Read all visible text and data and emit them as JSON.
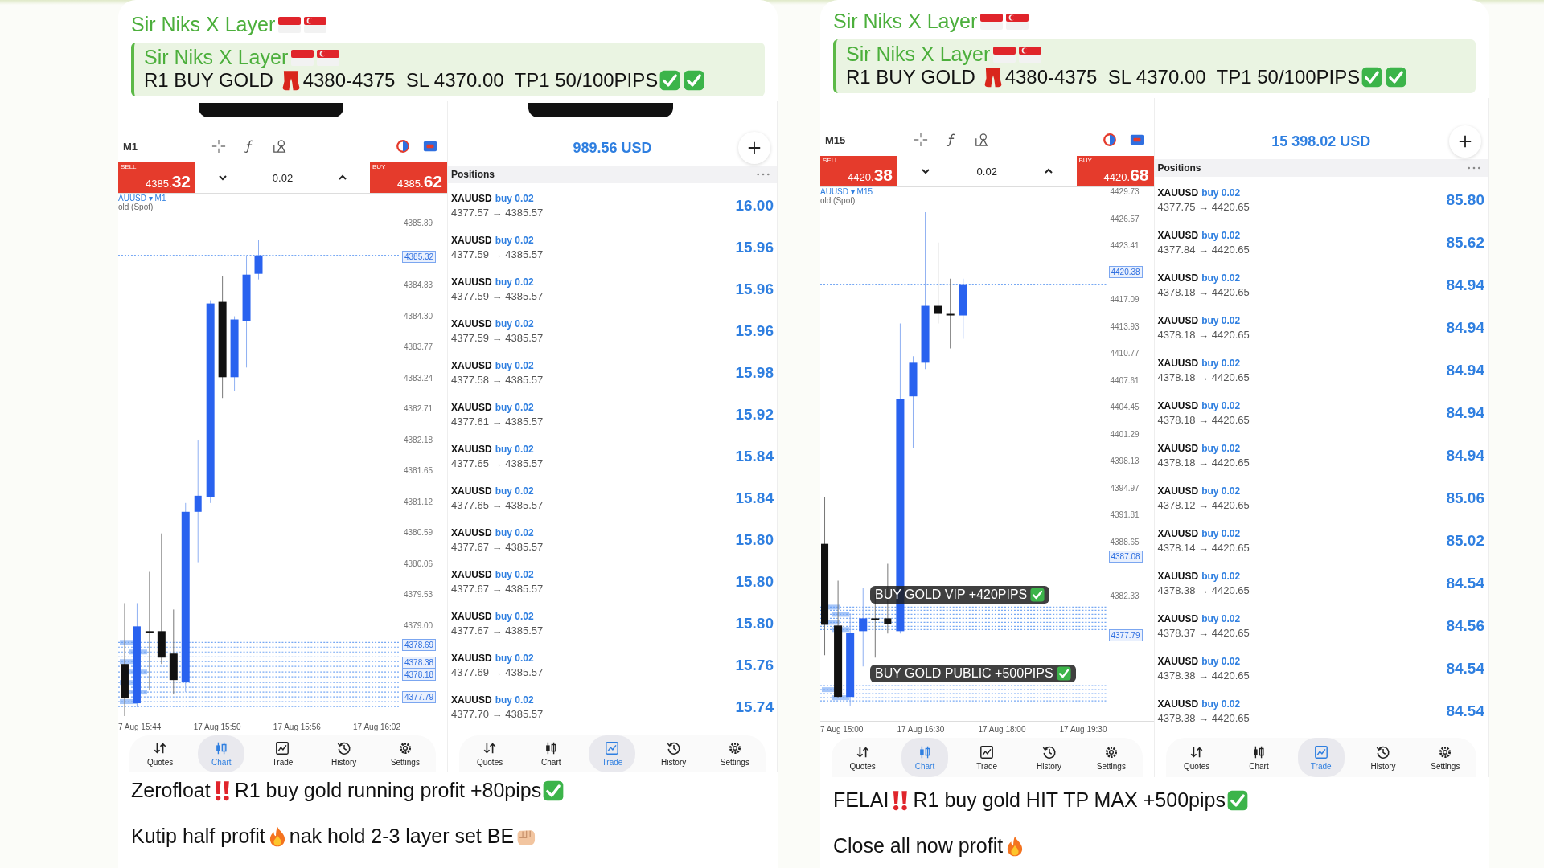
{
  "messages": [
    {
      "sender": "Sir Niks X Layer",
      "reply": {
        "sender": "Sir Niks X Layer",
        "segments": [
          {
            "kind": "text",
            "text": "R1 BUY GOLD "
          },
          {
            "kind": "boots"
          },
          {
            "kind": "text",
            "text": "4380-4375  SL 4370.00  TP1 50/100PIPS"
          },
          {
            "kind": "check"
          },
          {
            "kind": "check"
          }
        ]
      },
      "chart_screen": {
        "notch": true,
        "timeframe": "M1",
        "sell": {
          "label": "SELL",
          "price_main": "4385.",
          "price_big": "32"
        },
        "lot": "0.02",
        "buy": {
          "label": "BUY",
          "price_main": "4385.",
          "price_big": "62"
        },
        "symbol_line": "AUUSD ▾ M1",
        "description": "old (Spot)",
        "y_axis": [
          {
            "label": "4385.89",
            "kind": "tick"
          },
          {
            "label": "4385.32",
            "kind": "tag"
          },
          {
            "label": "4384.83",
            "kind": "tick"
          },
          {
            "label": "4384.30",
            "kind": "tick"
          },
          {
            "label": "4383.77",
            "kind": "tick"
          },
          {
            "label": "4383.24",
            "kind": "tick"
          },
          {
            "label": "4382.71",
            "kind": "tick"
          },
          {
            "label": "4382.18",
            "kind": "tick"
          },
          {
            "label": "4381.65",
            "kind": "tick"
          },
          {
            "label": "4381.12",
            "kind": "tick"
          },
          {
            "label": "4380.59",
            "kind": "tick"
          },
          {
            "label": "4380.06",
            "kind": "tick"
          },
          {
            "label": "4379.53",
            "kind": "tick"
          },
          {
            "label": "4379.00",
            "kind": "tick"
          },
          {
            "label": "4378.69",
            "kind": "tag"
          },
          {
            "label": "4378.38",
            "kind": "tag"
          },
          {
            "label": "4378.18",
            "kind": "tag"
          },
          {
            "label": "4377.79",
            "kind": "tag"
          }
        ],
        "x_axis": [
          "7 Aug 15:44",
          "17 Aug 15:50",
          "17 Aug 15:56",
          "17 Aug 16:02"
        ],
        "nav": [
          {
            "label": "Quotes",
            "selected": false
          },
          {
            "label": "Chart",
            "selected": true
          },
          {
            "label": "Trade",
            "selected": false
          },
          {
            "label": "History",
            "selected": false
          },
          {
            "label": "Settings",
            "selected": false
          }
        ]
      },
      "trade_screen": {
        "notch": true,
        "balance": "989.56 USD",
        "positions_title": "Positions",
        "positions": [
          {
            "symbol": "XAUUSD",
            "side": "buy 0.02",
            "prices": "4377.57 → 4385.57",
            "profit": "16.00"
          },
          {
            "symbol": "XAUUSD",
            "side": "buy 0.02",
            "prices": "4377.59 → 4385.57",
            "profit": "15.96"
          },
          {
            "symbol": "XAUUSD",
            "side": "buy 0.02",
            "prices": "4377.59 → 4385.57",
            "profit": "15.96"
          },
          {
            "symbol": "XAUUSD",
            "side": "buy 0.02",
            "prices": "4377.59 → 4385.57",
            "profit": "15.96"
          },
          {
            "symbol": "XAUUSD",
            "side": "buy 0.02",
            "prices": "4377.58 → 4385.57",
            "profit": "15.98"
          },
          {
            "symbol": "XAUUSD",
            "side": "buy 0.02",
            "prices": "4377.61 → 4385.57",
            "profit": "15.92"
          },
          {
            "symbol": "XAUUSD",
            "side": "buy 0.02",
            "prices": "4377.65 → 4385.57",
            "profit": "15.84"
          },
          {
            "symbol": "XAUUSD",
            "side": "buy 0.02",
            "prices": "4377.65 → 4385.57",
            "profit": "15.84"
          },
          {
            "symbol": "XAUUSD",
            "side": "buy 0.02",
            "prices": "4377.67 → 4385.57",
            "profit": "15.80"
          },
          {
            "symbol": "XAUUSD",
            "side": "buy 0.02",
            "prices": "4377.67 → 4385.57",
            "profit": "15.80"
          },
          {
            "symbol": "XAUUSD",
            "side": "buy 0.02",
            "prices": "4377.67 → 4385.57",
            "profit": "15.80"
          },
          {
            "symbol": "XAUUSD",
            "side": "buy 0.02",
            "prices": "4377.69 → 4385.57",
            "profit": "15.76"
          },
          {
            "symbol": "XAUUSD",
            "side": "buy 0.02",
            "prices": "4377.70 → 4385.57",
            "profit": "15.74"
          }
        ],
        "nav": [
          {
            "label": "Quotes",
            "selected": false
          },
          {
            "label": "Chart",
            "selected": false
          },
          {
            "label": "Trade",
            "selected": true
          },
          {
            "label": "History",
            "selected": false
          },
          {
            "label": "Settings",
            "selected": false
          }
        ]
      },
      "caption_lines": [
        [
          {
            "kind": "text",
            "text": "Zerofloat"
          },
          {
            "kind": "alert"
          },
          {
            "kind": "text",
            "text": "R1 buy gold running profit +80pips"
          },
          {
            "kind": "check"
          }
        ],
        [
          {
            "kind": "text",
            "text": "Kutip half profit"
          },
          {
            "kind": "fire"
          },
          {
            "kind": "text",
            "text": "nak hold 2-3 layer set BE"
          },
          {
            "kind": "fist"
          }
        ]
      ]
    },
    {
      "sender": "Sir Niks X Layer",
      "reply": {
        "sender": "Sir Niks X Layer",
        "segments": [
          {
            "kind": "text",
            "text": "R1 BUY GOLD "
          },
          {
            "kind": "boots"
          },
          {
            "kind": "text",
            "text": "4380-4375  SL 4370.00  TP1 50/100PIPS"
          },
          {
            "kind": "check"
          },
          {
            "kind": "check"
          }
        ]
      },
      "chart_screen": {
        "notch": false,
        "timeframe": "M15",
        "sell": {
          "label": "SELL",
          "price_main": "4420.",
          "price_big": "38"
        },
        "lot": "0.02",
        "buy": {
          "label": "BUY",
          "price_main": "4420.",
          "price_big": "68"
        },
        "symbol_line": "AUUSD ▾ M15",
        "description": "old (Spot)",
        "y_axis": [
          {
            "label": "4429.73",
            "kind": "tick"
          },
          {
            "label": "4426.57",
            "kind": "tick"
          },
          {
            "label": "4423.41",
            "kind": "tick"
          },
          {
            "label": "4420.38",
            "kind": "tag"
          },
          {
            "label": "4417.09",
            "kind": "tick"
          },
          {
            "label": "4413.93",
            "kind": "tick"
          },
          {
            "label": "4410.77",
            "kind": "tick"
          },
          {
            "label": "4407.61",
            "kind": "tick"
          },
          {
            "label": "4404.45",
            "kind": "tick"
          },
          {
            "label": "4401.29",
            "kind": "tick"
          },
          {
            "label": "4398.13",
            "kind": "tick"
          },
          {
            "label": "4394.97",
            "kind": "tick"
          },
          {
            "label": "4391.81",
            "kind": "tick"
          },
          {
            "label": "4388.65",
            "kind": "tick"
          },
          {
            "label": "4387.08",
            "kind": "tag"
          },
          {
            "label": "4382.33",
            "kind": "tick"
          },
          {
            "label": "4377.79",
            "kind": "tag"
          }
        ],
        "x_axis": [
          "7 Aug 15:00",
          "17 Aug 16:30",
          "17 Aug 18:00",
          "17 Aug 19:30"
        ],
        "annotations": [
          {
            "text": "BUY GOLD VIP +420PIPS"
          },
          {
            "text": "BUY GOLD PUBLIC +500PIPS"
          }
        ],
        "nav": [
          {
            "label": "Quotes",
            "selected": false
          },
          {
            "label": "Chart",
            "selected": true
          },
          {
            "label": "Trade",
            "selected": false
          },
          {
            "label": "History",
            "selected": false
          },
          {
            "label": "Settings",
            "selected": false
          }
        ]
      },
      "trade_screen": {
        "notch": false,
        "balance": "15 398.02 USD",
        "positions_title": "Positions",
        "positions": [
          {
            "symbol": "XAUUSD",
            "side": "buy 0.02",
            "prices": "4377.75 → 4420.65",
            "profit": "85.80"
          },
          {
            "symbol": "XAUUSD",
            "side": "buy 0.02",
            "prices": "4377.84 → 4420.65",
            "profit": "85.62"
          },
          {
            "symbol": "XAUUSD",
            "side": "buy 0.02",
            "prices": "4378.18 → 4420.65",
            "profit": "84.94"
          },
          {
            "symbol": "XAUUSD",
            "side": "buy 0.02",
            "prices": "4378.18 → 4420.65",
            "profit": "84.94"
          },
          {
            "symbol": "XAUUSD",
            "side": "buy 0.02",
            "prices": "4378.18 → 4420.65",
            "profit": "84.94"
          },
          {
            "symbol": "XAUUSD",
            "side": "buy 0.02",
            "prices": "4378.18 → 4420.65",
            "profit": "84.94"
          },
          {
            "symbol": "XAUUSD",
            "side": "buy 0.02",
            "prices": "4378.18 → 4420.65",
            "profit": "84.94"
          },
          {
            "symbol": "XAUUSD",
            "side": "buy 0.02",
            "prices": "4378.12 → 4420.65",
            "profit": "85.06"
          },
          {
            "symbol": "XAUUSD",
            "side": "buy 0.02",
            "prices": "4378.14 → 4420.65",
            "profit": "85.02"
          },
          {
            "symbol": "XAUUSD",
            "side": "buy 0.02",
            "prices": "4378.38 → 4420.65",
            "profit": "84.54"
          },
          {
            "symbol": "XAUUSD",
            "side": "buy 0.02",
            "prices": "4378.37 → 4420.65",
            "profit": "84.56"
          },
          {
            "symbol": "XAUUSD",
            "side": "buy 0.02",
            "prices": "4378.38 → 4420.65",
            "profit": "84.54"
          },
          {
            "symbol": "XAUUSD",
            "side": "buy 0.02",
            "prices": "4378.38 → 4420.65",
            "profit": "84.54"
          }
        ],
        "nav": [
          {
            "label": "Quotes",
            "selected": false
          },
          {
            "label": "Chart",
            "selected": false
          },
          {
            "label": "Trade",
            "selected": true
          },
          {
            "label": "History",
            "selected": false
          },
          {
            "label": "Settings",
            "selected": false
          }
        ]
      },
      "caption_lines": [
        [
          {
            "kind": "text",
            "text": "FELAI"
          },
          {
            "kind": "alert"
          },
          {
            "kind": "text",
            "text": "R1 buy gold HIT TP MAX +500pips"
          },
          {
            "kind": "check"
          }
        ],
        [
          {
            "kind": "text",
            "text": "Close all now profit"
          },
          {
            "kind": "fire"
          }
        ]
      ]
    }
  ]
}
